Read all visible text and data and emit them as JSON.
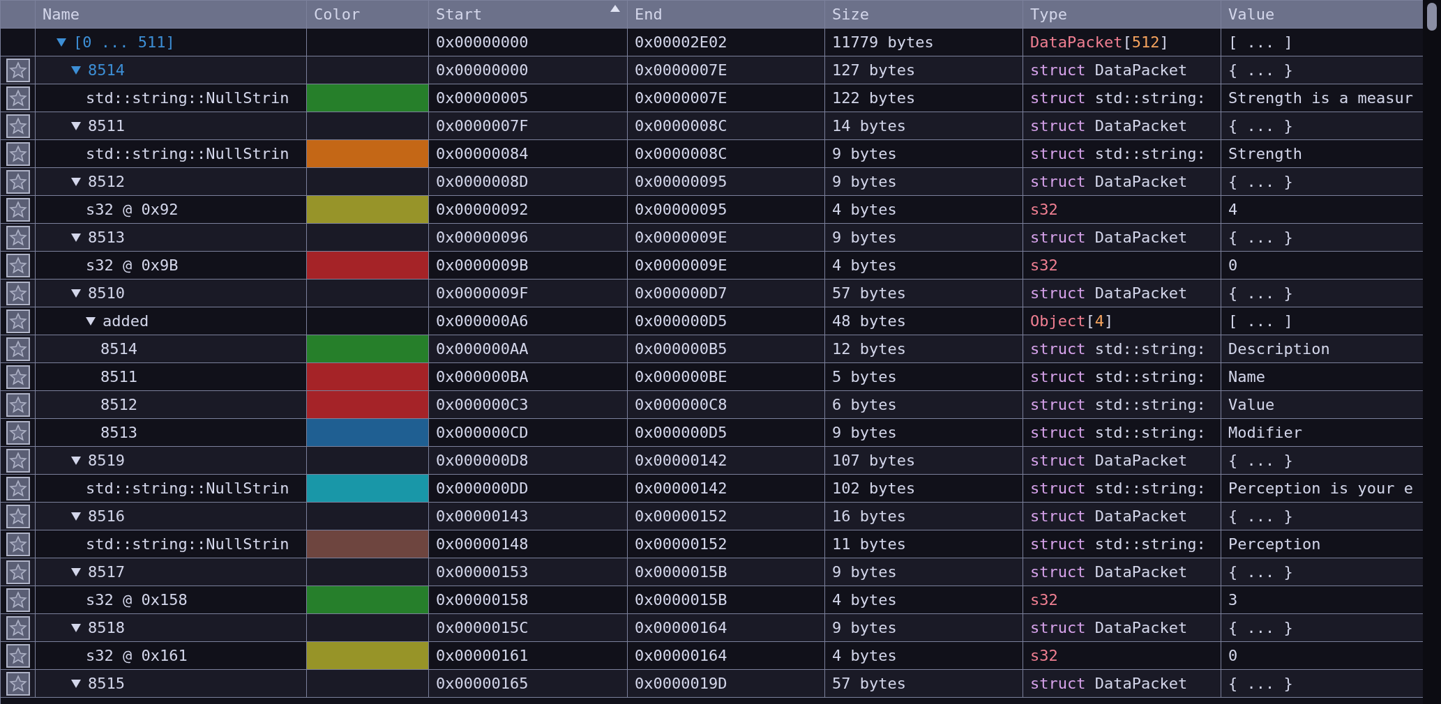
{
  "columns": [
    {
      "label": "Name",
      "sorted": false
    },
    {
      "label": "Color",
      "sorted": false
    },
    {
      "label": "Start",
      "sorted": true
    },
    {
      "label": "End",
      "sorted": false
    },
    {
      "label": "Size",
      "sorted": false
    },
    {
      "label": "Type",
      "sorted": false
    },
    {
      "label": "Value",
      "sorted": false
    }
  ],
  "rows": [
    {
      "name": "[0 ... 511]",
      "highlighted": true,
      "expanded": true,
      "bookmark_button": false,
      "start": "0x00000000",
      "end": "0x00002E02",
      "size": "11779 bytes",
      "type": {
        "kind": "array",
        "name": "DataPacket",
        "open": "[",
        "count": "512",
        "close": "]"
      },
      "value": "[ ... ]",
      "children": [
        {
          "name": "8514",
          "highlighted": true,
          "expanded": true,
          "bookmark_button": true,
          "start": "0x00000000",
          "end": "0x0000007E",
          "size": "127 bytes",
          "type": {
            "kind": "struct",
            "keyword": "struct",
            "name": "DataPacket"
          },
          "value": "{ ... }",
          "children": [
            {
              "name": "std::string::NullStrin",
              "highlighted": false,
              "bookmark_button": true,
              "color": "#267f2a",
              "start": "0x00000005",
              "end": "0x0000007E",
              "size": "122 bytes",
              "type": {
                "kind": "struct",
                "keyword": "struct",
                "name": "std::string:"
              },
              "value": "Strength is a measur"
            }
          ]
        },
        {
          "name": "8511",
          "highlighted": false,
          "expanded": true,
          "bookmark_button": true,
          "start": "0x0000007F",
          "end": "0x0000008C",
          "size": "14 bytes",
          "type": {
            "kind": "struct",
            "keyword": "struct",
            "name": "DataPacket"
          },
          "value": "{ ... }",
          "children": [
            {
              "name": "std::string::NullStrin",
              "highlighted": false,
              "bookmark_button": true,
              "color": "#c46716",
              "start": "0x00000084",
              "end": "0x0000008C",
              "size": "9 bytes",
              "type": {
                "kind": "struct",
                "keyword": "struct",
                "name": "std::string:"
              },
              "value": "Strength"
            }
          ]
        },
        {
          "name": "8512",
          "highlighted": false,
          "expanded": true,
          "bookmark_button": true,
          "start": "0x0000008D",
          "end": "0x00000095",
          "size": "9 bytes",
          "type": {
            "kind": "struct",
            "keyword": "struct",
            "name": "DataPacket"
          },
          "value": "{ ... }",
          "children": [
            {
              "name": "s32 @ 0x92",
              "highlighted": false,
              "bookmark_button": true,
              "color": "#979429",
              "start": "0x00000092",
              "end": "0x00000095",
              "size": "4 bytes",
              "type": {
                "kind": "builtin",
                "name": "s32"
              },
              "value": "4"
            }
          ]
        },
        {
          "name": "8513",
          "highlighted": false,
          "expanded": true,
          "bookmark_button": true,
          "start": "0x00000096",
          "end": "0x0000009E",
          "size": "9 bytes",
          "type": {
            "kind": "struct",
            "keyword": "struct",
            "name": "DataPacket"
          },
          "value": "{ ... }",
          "children": [
            {
              "name": "s32 @ 0x9B",
              "highlighted": false,
              "bookmark_button": true,
              "color": "#a52327",
              "start": "0x0000009B",
              "end": "0x0000009E",
              "size": "4 bytes",
              "type": {
                "kind": "builtin",
                "name": "s32"
              },
              "value": "0"
            }
          ]
        },
        {
          "name": "8510",
          "highlighted": false,
          "expanded": true,
          "bookmark_button": true,
          "start": "0x0000009F",
          "end": "0x000000D7",
          "size": "57 bytes",
          "type": {
            "kind": "struct",
            "keyword": "struct",
            "name": "DataPacket"
          },
          "value": "{ ... }",
          "children": [
            {
              "name": "added",
              "highlighted": false,
              "expanded": true,
              "bookmark_button": true,
              "start": "0x000000A6",
              "end": "0x000000D5",
              "size": "48 bytes",
              "type": {
                "kind": "array",
                "name": "Object",
                "open": "[",
                "count": "4",
                "close": "]"
              },
              "value": "[ ... ]",
              "children": [
                {
                  "name": "8514",
                  "highlighted": false,
                  "bookmark_button": true,
                  "color": "#267f2a",
                  "start": "0x000000AA",
                  "end": "0x000000B5",
                  "size": "12 bytes",
                  "type": {
                    "kind": "struct",
                    "keyword": "struct",
                    "name": "std::string:"
                  },
                  "value": "Description"
                },
                {
                  "name": "8511",
                  "highlighted": false,
                  "bookmark_button": true,
                  "color": "#a52327",
                  "start": "0x000000BA",
                  "end": "0x000000BE",
                  "size": "5 bytes",
                  "type": {
                    "kind": "struct",
                    "keyword": "struct",
                    "name": "std::string:"
                  },
                  "value": "Name"
                },
                {
                  "name": "8512",
                  "highlighted": false,
                  "bookmark_button": true,
                  "color": "#a52328",
                  "start": "0x000000C3",
                  "end": "0x000000C8",
                  "size": "6 bytes",
                  "type": {
                    "kind": "struct",
                    "keyword": "struct",
                    "name": "std::string:"
                  },
                  "value": "Value"
                },
                {
                  "name": "8513",
                  "highlighted": false,
                  "bookmark_button": true,
                  "color": "#1f5f92",
                  "start": "0x000000CD",
                  "end": "0x000000D5",
                  "size": "9 bytes",
                  "type": {
                    "kind": "struct",
                    "keyword": "struct",
                    "name": "std::string:"
                  },
                  "value": "Modifier"
                }
              ]
            }
          ]
        },
        {
          "name": "8519",
          "highlighted": false,
          "expanded": true,
          "bookmark_button": true,
          "start": "0x000000D8",
          "end": "0x00000142",
          "size": "107 bytes",
          "type": {
            "kind": "struct",
            "keyword": "struct",
            "name": "DataPacket"
          },
          "value": "{ ... }",
          "children": [
            {
              "name": "std::string::NullStrin",
              "highlighted": false,
              "bookmark_button": true,
              "color": "#1997a8",
              "start": "0x000000DD",
              "end": "0x00000142",
              "size": "102 bytes",
              "type": {
                "kind": "struct",
                "keyword": "struct",
                "name": "std::string:"
              },
              "value": "Perception is your e"
            }
          ]
        },
        {
          "name": "8516",
          "highlighted": false,
          "expanded": true,
          "bookmark_button": true,
          "start": "0x00000143",
          "end": "0x00000152",
          "size": "16 bytes",
          "type": {
            "kind": "struct",
            "keyword": "struct",
            "name": "DataPacket"
          },
          "value": "{ ... }",
          "children": [
            {
              "name": "std::string::NullStrin",
              "highlighted": false,
              "bookmark_button": true,
              "color": "#6e453f",
              "start": "0x00000148",
              "end": "0x00000152",
              "size": "11 bytes",
              "type": {
                "kind": "struct",
                "keyword": "struct",
                "name": "std::string:"
              },
              "value": "Perception"
            }
          ]
        },
        {
          "name": "8517",
          "highlighted": false,
          "expanded": true,
          "bookmark_button": true,
          "start": "0x00000153",
          "end": "0x0000015B",
          "size": "9 bytes",
          "type": {
            "kind": "struct",
            "keyword": "struct",
            "name": "DataPacket"
          },
          "value": "{ ... }",
          "children": [
            {
              "name": "s32 @ 0x158",
              "highlighted": false,
              "bookmark_button": true,
              "color": "#267f2b",
              "start": "0x00000158",
              "end": "0x0000015B",
              "size": "4 bytes",
              "type": {
                "kind": "builtin",
                "name": "s32"
              },
              "value": "3"
            }
          ]
        },
        {
          "name": "8518",
          "highlighted": false,
          "expanded": true,
          "bookmark_button": true,
          "start": "0x0000015C",
          "end": "0x00000164",
          "size": "9 bytes",
          "type": {
            "kind": "struct",
            "keyword": "struct",
            "name": "DataPacket"
          },
          "value": "{ ... }",
          "children": [
            {
              "name": "s32 @ 0x161",
              "highlighted": false,
              "bookmark_button": true,
              "color": "#979428",
              "start": "0x00000161",
              "end": "0x00000164",
              "size": "4 bytes",
              "type": {
                "kind": "builtin",
                "name": "s32"
              },
              "value": "0"
            }
          ]
        },
        {
          "name": "8515",
          "highlighted": false,
          "expanded": true,
          "bookmark_button": true,
          "start": "0x00000165",
          "end": "0x0000019D",
          "size": "57 bytes",
          "type": {
            "kind": "struct",
            "keyword": "struct",
            "name": "DataPacket"
          },
          "value": "{ ... }"
        }
      ]
    }
  ]
}
